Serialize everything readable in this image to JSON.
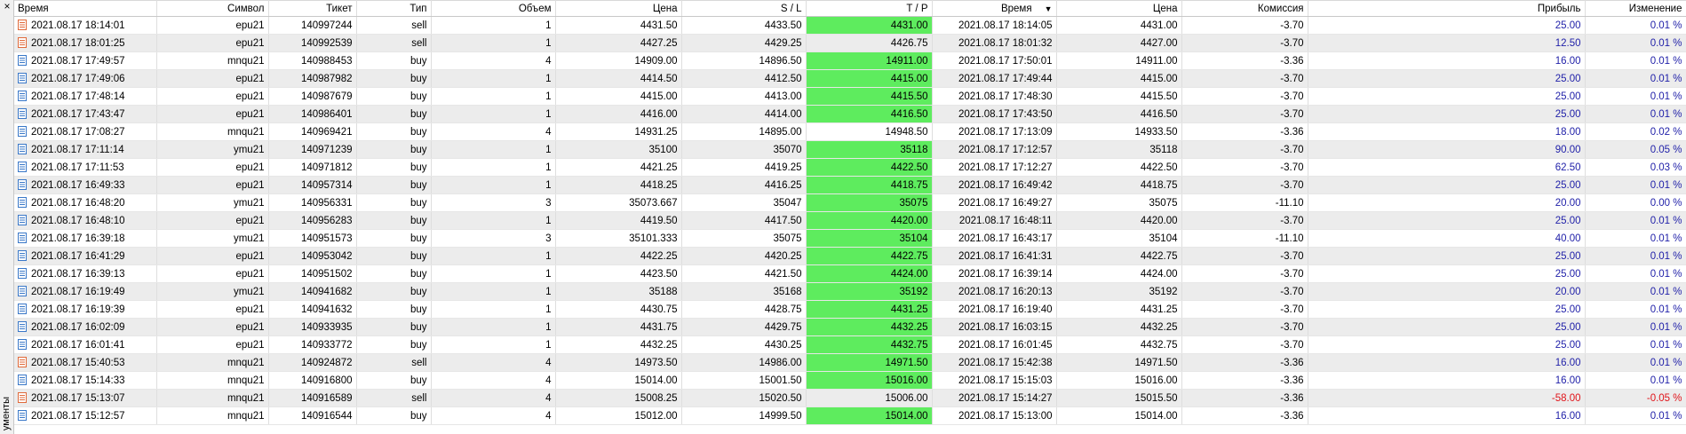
{
  "side_panel": {
    "close_glyph": "×",
    "label": "ументы"
  },
  "colors": {
    "buy_icon": "#3a78c8",
    "sell_icon": "#e06a3a",
    "tp_hit": "#5eec5e",
    "profit_positive": "#1f1fa8",
    "profit_negative": "#e0141a"
  },
  "icons": {
    "buy": "document-blue-icon",
    "sell": "document-orange-icon",
    "sort": "sort-down-arrow-icon"
  },
  "columns": [
    "Время",
    "Символ",
    "Тикет",
    "Тип",
    "Объем",
    "Цена",
    "S / L",
    "T / P",
    "Время",
    "Цена",
    "Комиссия",
    "Прибыль",
    "Изменение"
  ],
  "sort_arrow": "▼",
  "rows": [
    {
      "time_open": "2021.08.17 18:14:01",
      "symbol": "epu21",
      "ticket": "140997244",
      "type": "sell",
      "volume": "1",
      "price_open": "4431.50",
      "sl": "4433.50",
      "tp": "4431.00",
      "tp_hit": true,
      "time_close": "2021.08.17 18:14:05",
      "price_close": "4431.00",
      "commission": "-3.70",
      "profit": "25.00",
      "change": "0.01 %"
    },
    {
      "time_open": "2021.08.17 18:01:25",
      "symbol": "epu21",
      "ticket": "140992539",
      "type": "sell",
      "volume": "1",
      "price_open": "4427.25",
      "sl": "4429.25",
      "tp": "4426.75",
      "tp_hit": false,
      "time_close": "2021.08.17 18:01:32",
      "price_close": "4427.00",
      "commission": "-3.70",
      "profit": "12.50",
      "change": "0.01 %"
    },
    {
      "time_open": "2021.08.17 17:49:57",
      "symbol": "mnqu21",
      "ticket": "140988453",
      "type": "buy",
      "volume": "4",
      "price_open": "14909.00",
      "sl": "14896.50",
      "tp": "14911.00",
      "tp_hit": true,
      "time_close": "2021.08.17 17:50:01",
      "price_close": "14911.00",
      "commission": "-3.36",
      "profit": "16.00",
      "change": "0.01 %"
    },
    {
      "time_open": "2021.08.17 17:49:06",
      "symbol": "epu21",
      "ticket": "140987982",
      "type": "buy",
      "volume": "1",
      "price_open": "4414.50",
      "sl": "4412.50",
      "tp": "4415.00",
      "tp_hit": true,
      "time_close": "2021.08.17 17:49:44",
      "price_close": "4415.00",
      "commission": "-3.70",
      "profit": "25.00",
      "change": "0.01 %"
    },
    {
      "time_open": "2021.08.17 17:48:14",
      "symbol": "epu21",
      "ticket": "140987679",
      "type": "buy",
      "volume": "1",
      "price_open": "4415.00",
      "sl": "4413.00",
      "tp": "4415.50",
      "tp_hit": true,
      "time_close": "2021.08.17 17:48:30",
      "price_close": "4415.50",
      "commission": "-3.70",
      "profit": "25.00",
      "change": "0.01 %"
    },
    {
      "time_open": "2021.08.17 17:43:47",
      "symbol": "epu21",
      "ticket": "140986401",
      "type": "buy",
      "volume": "1",
      "price_open": "4416.00",
      "sl": "4414.00",
      "tp": "4416.50",
      "tp_hit": true,
      "time_close": "2021.08.17 17:43:50",
      "price_close": "4416.50",
      "commission": "-3.70",
      "profit": "25.00",
      "change": "0.01 %"
    },
    {
      "time_open": "2021.08.17 17:08:27",
      "symbol": "mnqu21",
      "ticket": "140969421",
      "type": "buy",
      "volume": "4",
      "price_open": "14931.25",
      "sl": "14895.00",
      "tp": "14948.50",
      "tp_hit": false,
      "time_close": "2021.08.17 17:13:09",
      "price_close": "14933.50",
      "commission": "-3.36",
      "profit": "18.00",
      "change": "0.02 %"
    },
    {
      "time_open": "2021.08.17 17:11:14",
      "symbol": "ymu21",
      "ticket": "140971239",
      "type": "buy",
      "volume": "1",
      "price_open": "35100",
      "sl": "35070",
      "tp": "35118",
      "tp_hit": true,
      "time_close": "2021.08.17 17:12:57",
      "price_close": "35118",
      "commission": "-3.70",
      "profit": "90.00",
      "change": "0.05 %"
    },
    {
      "time_open": "2021.08.17 17:11:53",
      "symbol": "epu21",
      "ticket": "140971812",
      "type": "buy",
      "volume": "1",
      "price_open": "4421.25",
      "sl": "4419.25",
      "tp": "4422.50",
      "tp_hit": true,
      "time_close": "2021.08.17 17:12:27",
      "price_close": "4422.50",
      "commission": "-3.70",
      "profit": "62.50",
      "change": "0.03 %"
    },
    {
      "time_open": "2021.08.17 16:49:33",
      "symbol": "epu21",
      "ticket": "140957314",
      "type": "buy",
      "volume": "1",
      "price_open": "4418.25",
      "sl": "4416.25",
      "tp": "4418.75",
      "tp_hit": true,
      "time_close": "2021.08.17 16:49:42",
      "price_close": "4418.75",
      "commission": "-3.70",
      "profit": "25.00",
      "change": "0.01 %"
    },
    {
      "time_open": "2021.08.17 16:48:20",
      "symbol": "ymu21",
      "ticket": "140956331",
      "type": "buy",
      "volume": "3",
      "price_open": "35073.667",
      "sl": "35047",
      "tp": "35075",
      "tp_hit": true,
      "time_close": "2021.08.17 16:49:27",
      "price_close": "35075",
      "commission": "-11.10",
      "profit": "20.00",
      "change": "0.00 %"
    },
    {
      "time_open": "2021.08.17 16:48:10",
      "symbol": "epu21",
      "ticket": "140956283",
      "type": "buy",
      "volume": "1",
      "price_open": "4419.50",
      "sl": "4417.50",
      "tp": "4420.00",
      "tp_hit": true,
      "time_close": "2021.08.17 16:48:11",
      "price_close": "4420.00",
      "commission": "-3.70",
      "profit": "25.00",
      "change": "0.01 %"
    },
    {
      "time_open": "2021.08.17 16:39:18",
      "symbol": "ymu21",
      "ticket": "140951573",
      "type": "buy",
      "volume": "3",
      "price_open": "35101.333",
      "sl": "35075",
      "tp": "35104",
      "tp_hit": true,
      "time_close": "2021.08.17 16:43:17",
      "price_close": "35104",
      "commission": "-11.10",
      "profit": "40.00",
      "change": "0.01 %"
    },
    {
      "time_open": "2021.08.17 16:41:29",
      "symbol": "epu21",
      "ticket": "140953042",
      "type": "buy",
      "volume": "1",
      "price_open": "4422.25",
      "sl": "4420.25",
      "tp": "4422.75",
      "tp_hit": true,
      "time_close": "2021.08.17 16:41:31",
      "price_close": "4422.75",
      "commission": "-3.70",
      "profit": "25.00",
      "change": "0.01 %"
    },
    {
      "time_open": "2021.08.17 16:39:13",
      "symbol": "epu21",
      "ticket": "140951502",
      "type": "buy",
      "volume": "1",
      "price_open": "4423.50",
      "sl": "4421.50",
      "tp": "4424.00",
      "tp_hit": true,
      "time_close": "2021.08.17 16:39:14",
      "price_close": "4424.00",
      "commission": "-3.70",
      "profit": "25.00",
      "change": "0.01 %"
    },
    {
      "time_open": "2021.08.17 16:19:49",
      "symbol": "ymu21",
      "ticket": "140941682",
      "type": "buy",
      "volume": "1",
      "price_open": "35188",
      "sl": "35168",
      "tp": "35192",
      "tp_hit": true,
      "time_close": "2021.08.17 16:20:13",
      "price_close": "35192",
      "commission": "-3.70",
      "profit": "20.00",
      "change": "0.01 %"
    },
    {
      "time_open": "2021.08.17 16:19:39",
      "symbol": "epu21",
      "ticket": "140941632",
      "type": "buy",
      "volume": "1",
      "price_open": "4430.75",
      "sl": "4428.75",
      "tp": "4431.25",
      "tp_hit": true,
      "time_close": "2021.08.17 16:19:40",
      "price_close": "4431.25",
      "commission": "-3.70",
      "profit": "25.00",
      "change": "0.01 %"
    },
    {
      "time_open": "2021.08.17 16:02:09",
      "symbol": "epu21",
      "ticket": "140933935",
      "type": "buy",
      "volume": "1",
      "price_open": "4431.75",
      "sl": "4429.75",
      "tp": "4432.25",
      "tp_hit": true,
      "time_close": "2021.08.17 16:03:15",
      "price_close": "4432.25",
      "commission": "-3.70",
      "profit": "25.00",
      "change": "0.01 %"
    },
    {
      "time_open": "2021.08.17 16:01:41",
      "symbol": "epu21",
      "ticket": "140933772",
      "type": "buy",
      "volume": "1",
      "price_open": "4432.25",
      "sl": "4430.25",
      "tp": "4432.75",
      "tp_hit": true,
      "time_close": "2021.08.17 16:01:45",
      "price_close": "4432.75",
      "commission": "-3.70",
      "profit": "25.00",
      "change": "0.01 %"
    },
    {
      "time_open": "2021.08.17 15:40:53",
      "symbol": "mnqu21",
      "ticket": "140924872",
      "type": "sell",
      "volume": "4",
      "price_open": "14973.50",
      "sl": "14986.00",
      "tp": "14971.50",
      "tp_hit": true,
      "time_close": "2021.08.17 15:42:38",
      "price_close": "14971.50",
      "commission": "-3.36",
      "profit": "16.00",
      "change": "0.01 %"
    },
    {
      "time_open": "2021.08.17 15:14:33",
      "symbol": "mnqu21",
      "ticket": "140916800",
      "type": "buy",
      "volume": "4",
      "price_open": "15014.00",
      "sl": "15001.50",
      "tp": "15016.00",
      "tp_hit": true,
      "time_close": "2021.08.17 15:15:03",
      "price_close": "15016.00",
      "commission": "-3.36",
      "profit": "16.00",
      "change": "0.01 %"
    },
    {
      "time_open": "2021.08.17 15:13:07",
      "symbol": "mnqu21",
      "ticket": "140916589",
      "type": "sell",
      "volume": "4",
      "price_open": "15008.25",
      "sl": "15020.50",
      "tp": "15006.00",
      "tp_hit": false,
      "time_close": "2021.08.17 15:14:27",
      "price_close": "15015.50",
      "commission": "-3.36",
      "profit": "-58.00",
      "change": "-0.05 %"
    },
    {
      "time_open": "2021.08.17 15:12:57",
      "symbol": "mnqu21",
      "ticket": "140916544",
      "type": "buy",
      "volume": "4",
      "price_open": "15012.00",
      "sl": "14999.50",
      "tp": "15014.00",
      "tp_hit": true,
      "time_close": "2021.08.17 15:13:00",
      "price_close": "15014.00",
      "commission": "-3.36",
      "profit": "16.00",
      "change": "0.01 %"
    }
  ]
}
